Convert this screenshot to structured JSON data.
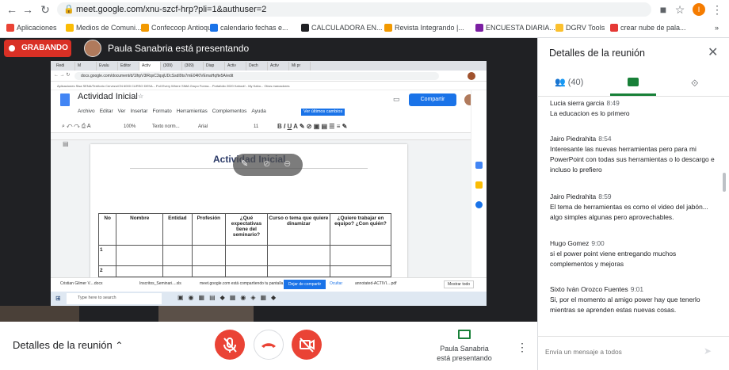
{
  "browser": {
    "url": "meet.google.com/xnu-szcf-hrp?pli=1&authuser=2",
    "profile_initial": "I",
    "bookmarks": [
      {
        "label": "Aplicaciones",
        "color": "#ea4335"
      },
      {
        "label": "Medios de Comuni...",
        "color": "#fbbc04"
      },
      {
        "label": "Confecoop Antioquia",
        "color": "#f29900"
      },
      {
        "label": "calendario fechas e...",
        "color": "#1a73e8"
      },
      {
        "label": "CALCULADORA EN...",
        "color": "#202124"
      },
      {
        "label": "Revista Integrando |...",
        "color": "#f29900"
      },
      {
        "label": "ENCUESTA DIARIA...",
        "color": "#7b1fa2"
      },
      {
        "label": "DGRV Tools",
        "color": "#fbc02d"
      },
      {
        "label": "crear nube de pala...",
        "color": "#e53935"
      }
    ],
    "more": "»"
  },
  "meeting": {
    "recording_label": "GRABANDO",
    "presenter_banner": "Paula Sanabria está presentando",
    "details_label": "Detalles de la reunión",
    "presenting_tile_name": "Paula Sanabria",
    "presenting_tile_status": "está presentando"
  },
  "shared_doc": {
    "title": "Actividad Inicial",
    "menu": [
      "Archivo",
      "Editar",
      "Ver",
      "Insertar",
      "Formato",
      "Herramientas",
      "Complementos",
      "Ayuda"
    ],
    "last_change": "Ver últimos cambios",
    "share_label": "Compartir",
    "zoom": "100%",
    "style": "Texto norm...",
    "font": "Arial",
    "size": "11",
    "heading": "Actividad Inicial",
    "table_headers": [
      "No",
      "Nombre",
      "Entidad",
      "Profesión",
      "¿Qué expectativas tiene del seminario?",
      "Curso o tema que quiere dinamizar",
      "¿Quiere trabajar en equipo? ¿Con quién?"
    ],
    "row_numbers": [
      "1",
      "2"
    ],
    "share_notice": "meet.google.com está compartiendo tu pantalla.",
    "stop_share": "Dejar de compartir",
    "hide": "Ocultar",
    "downloads": [
      "Cristian Gilmer V....docx",
      "Inscritos_Seminari....xls",
      "annotated-ACTIVI....pdf"
    ],
    "show_all": "Mostrar todo",
    "search": "Type here to search",
    "tabs": [
      "Redi",
      "M",
      "Evalu",
      "Editor",
      "Activ",
      "(309)",
      "(309)",
      "Diap",
      "Activ",
      "Dech",
      "Activ",
      "Mi pr"
    ],
    "address": "docs.google.com/document/d/1lhpV3lRqxC3qsjUDcSsdI9ts7mE04l0VEmaHqfte5A/edit",
    "bookmarks_line": "Aplicaciones   Sisa   SENA/Territorio   Cervezo/CN   6000 CURSO DESA...   Poll Every Where   SIMA Grupo Forma...   Portafolio 2020   Kahoot! - My Kaho...   Otros marcadores"
  },
  "sidebar": {
    "title": "Detalles de la reunión",
    "people_count": "(40)",
    "messages": [
      {
        "name": "Lucia sierra garcia",
        "time": "8:49",
        "text": "La educacion es lo primero"
      },
      {
        "name": "Jairo Piedrahita",
        "time": "8:54",
        "text": "Interesante las nuevas herramientas pero para mi PowerPoint con todas sus herramientas o lo descargo e incluso lo prefiero"
      },
      {
        "name": "Jairo Piedrahita",
        "time": "8:59",
        "text": "El tema de herramientas es como el video del jabón... algo simples algunas pero aprovechables."
      },
      {
        "name": "Hugo Gomez",
        "time": "9:00",
        "text": "si el power point viene entregando muchos complementos y mejoras"
      },
      {
        "name": "Sixto Iván Orozco Fuentes",
        "time": "9:01",
        "text": "Si, por el momento al amigo power hay que tenerlo mientras se aprenden estas nuevas cosas."
      }
    ],
    "input_placeholder": "Envía un mensaje a todos"
  },
  "colors": {
    "accent": "#1a73e8",
    "danger": "#d93025",
    "chat_active": "#188038"
  }
}
